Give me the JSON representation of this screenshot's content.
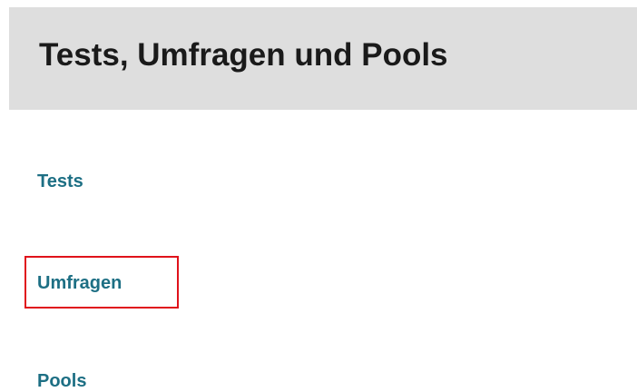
{
  "header": {
    "title": "Tests, Umfragen und Pools"
  },
  "nav": {
    "items": [
      {
        "label": "Tests"
      },
      {
        "label": "Umfragen",
        "highlighted": true
      },
      {
        "label": "Pools"
      }
    ]
  },
  "colors": {
    "header_background": "#dedede",
    "title_text": "#1a1a1a",
    "link_text": "#1d6f84",
    "highlight_border": "#e0121b"
  }
}
